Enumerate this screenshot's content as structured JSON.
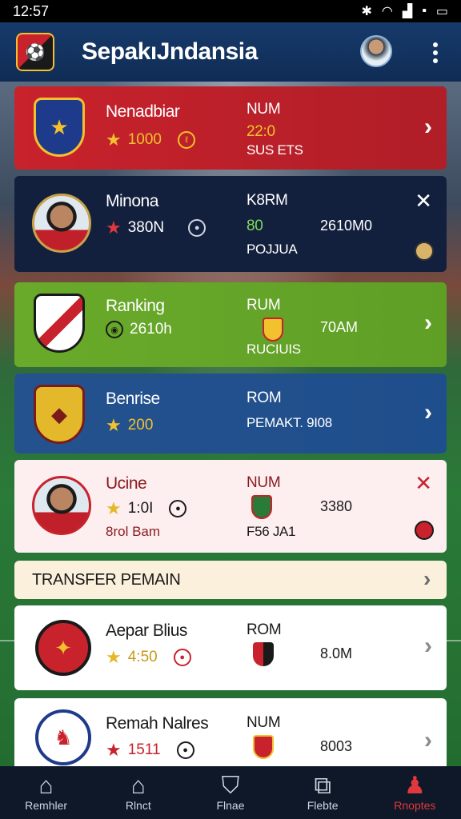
{
  "status": {
    "time": "12:57"
  },
  "app": {
    "title": "SepakıJndansia"
  },
  "cards": [
    {
      "name": "Nenadbiar",
      "stat": "1000",
      "col2_top": "NUM",
      "col2_mid": "22:0",
      "col2_bot": "SUS ETS"
    },
    {
      "name": "Minona",
      "stat": "380N",
      "col2_top": "K8RM",
      "col2_mid": "80",
      "col3": "2610M0",
      "col2_bot": "POJJUA"
    },
    {
      "name": "Ranking",
      "stat": "2610h",
      "col2_top": "RUM",
      "col3": "70AM",
      "col2_bot": "RUCIUIS"
    },
    {
      "name": "Benrise",
      "stat": "200",
      "col2_top": "ROM",
      "col2_bot": "PEMAKT. 9I08"
    },
    {
      "name": "Ucine",
      "stat": "1:0I",
      "col2_top": "NUM",
      "col3": "3380",
      "stat2": "8rol Bam",
      "col2_bot": "F56 JA1"
    }
  ],
  "section": {
    "label": "TRANSFER PEMAIN"
  },
  "transfers": [
    {
      "name": "Aepar Blius",
      "stat": "4:50",
      "col2_top": "ROM",
      "col3": "8.0M"
    },
    {
      "name": "Remah Nalres",
      "stat": "1511",
      "col2_top": "NUM",
      "col3": "8003"
    }
  ],
  "nav": [
    {
      "label": "Remhler",
      "icon": "home-icon"
    },
    {
      "label": "Rlnct",
      "icon": "house-outline-icon"
    },
    {
      "label": "Flnae",
      "icon": "shield-icon"
    },
    {
      "label": "Flebte",
      "icon": "puzzle-icon"
    },
    {
      "label": "Rnoptes",
      "icon": "user-icon"
    }
  ],
  "colors": {
    "appbar": "#163a6b",
    "card_red": "#c8222c",
    "card_navy": "#13203d",
    "card_green": "#6aaa2a",
    "card_blue": "#1f4e8c",
    "card_pink": "#fdeef0",
    "nav_active": "#e0383d",
    "star_gold": "#f2c12e"
  }
}
